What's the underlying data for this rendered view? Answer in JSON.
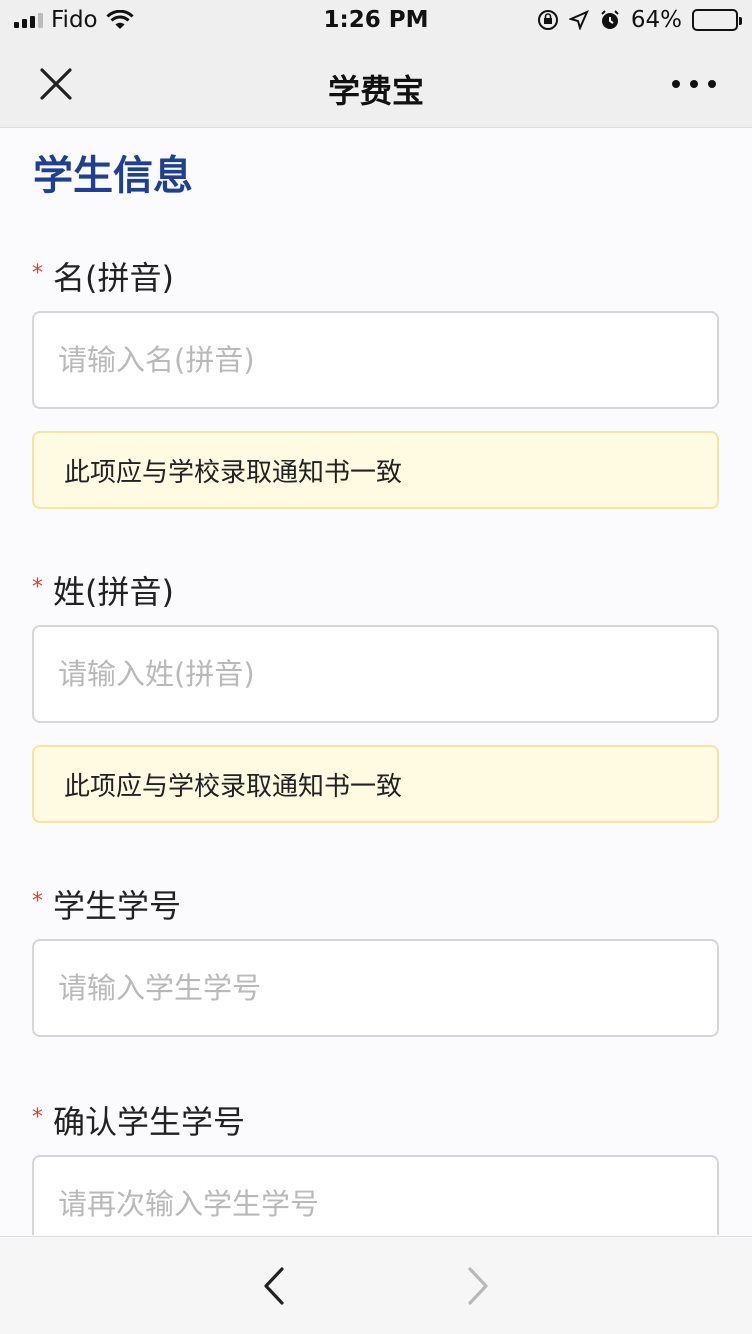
{
  "status_bar": {
    "carrier": "Fido",
    "time": "1:26 PM",
    "battery_percent": "64%",
    "battery_level": 0.64
  },
  "nav_bar": {
    "title": "学费宝",
    "left_icon": "close-icon",
    "right_icon": "more-icon"
  },
  "form": {
    "section_title": "学生信息",
    "fields": [
      {
        "label": "名(拼音)",
        "required_mark": "*",
        "placeholder": "请输入名(拼音)",
        "value": "",
        "hint": "此项应与学校录取通知书一致"
      },
      {
        "label": "姓(拼音)",
        "required_mark": "*",
        "placeholder": "请输入姓(拼音)",
        "value": "",
        "hint": "此项应与学校录取通知书一致"
      },
      {
        "label": "学生学号",
        "required_mark": "*",
        "placeholder": "请输入学生学号",
        "value": ""
      },
      {
        "label": "确认学生学号",
        "required_mark": "*",
        "placeholder": "请再次输入学生学号",
        "value": ""
      }
    ]
  },
  "bottom_bar": {
    "back_icon": "chevron-left-icon",
    "forward_icon": "chevron-right-icon",
    "back_color": "#222222",
    "forward_color": "#b8b8b8"
  },
  "colors": {
    "section_title": "#1f3f8f",
    "required": "#d0463b",
    "hint_bg": "#fffbe2",
    "hint_border": "#f3e6a1"
  }
}
